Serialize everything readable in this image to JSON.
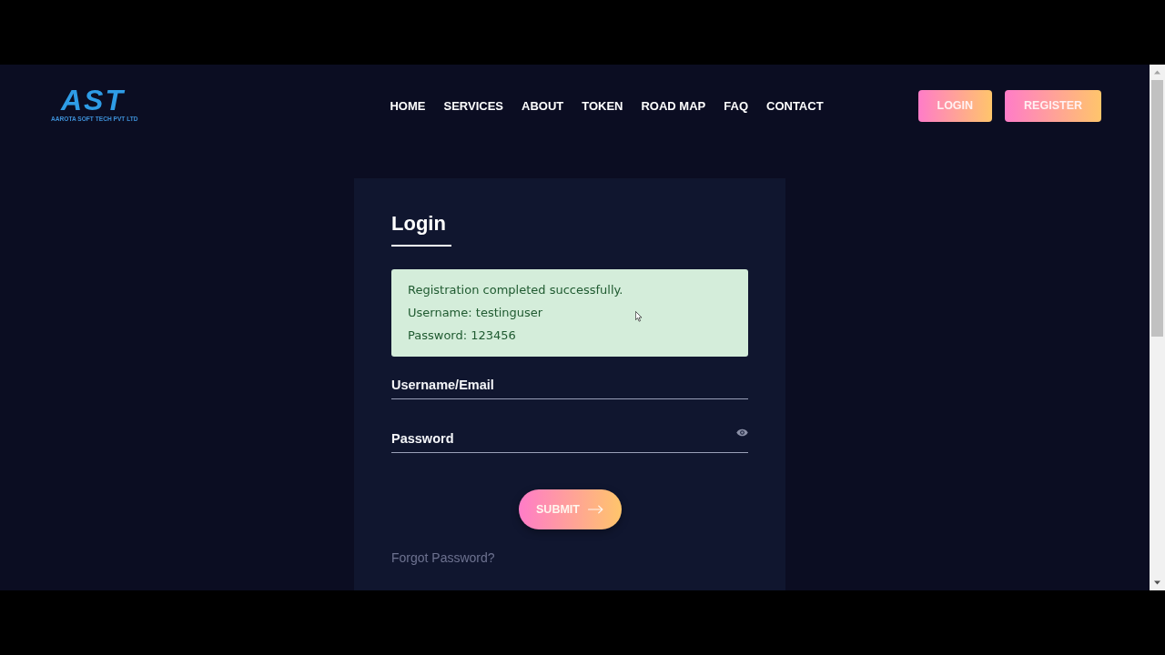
{
  "header": {
    "logo": {
      "mark": "AST",
      "tagline": "AAROTA SOFT TECH PVT LTD"
    },
    "nav": [
      "HOME",
      "SERVICES",
      "ABOUT",
      "TOKEN",
      "ROAD MAP",
      "FAQ",
      "CONTACT"
    ],
    "buttons": [
      "LOGIN",
      "REGISTER"
    ]
  },
  "login_card": {
    "title": "Login",
    "alert": {
      "kind": "success",
      "lines": [
        "Registration completed successfully.",
        "Username: testinguser",
        "Password: 123456"
      ]
    },
    "fields": [
      {
        "kind": "text",
        "placeholder": "Username/Email"
      },
      {
        "kind": "password",
        "placeholder": "Password"
      }
    ],
    "submit": {
      "label": "SUBMIT"
    },
    "forgot_link": "Forgot Password?"
  }
}
